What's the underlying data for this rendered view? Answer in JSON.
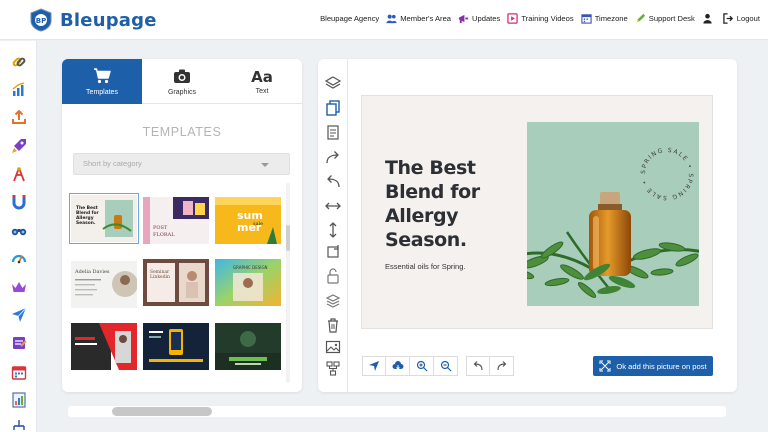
{
  "brand": {
    "name": "Bleupage",
    "logo_text": "BP"
  },
  "topnav": [
    {
      "label": "Bleupage Agency",
      "icon": "none"
    },
    {
      "label": "Member's Area",
      "icon": "users-icon"
    },
    {
      "label": "Updates",
      "icon": "megaphone-icon"
    },
    {
      "label": "Training Videos",
      "icon": "video-icon"
    },
    {
      "label": "Timezone",
      "icon": "calendar-icon"
    },
    {
      "label": "Support Desk",
      "icon": "pencil-icon"
    },
    {
      "label": "",
      "icon": "user-icon"
    },
    {
      "label": "Logout",
      "icon": "logout-icon"
    }
  ],
  "sidebar_icons": [
    "link-icon",
    "bar-chart-icon",
    "upload-icon",
    "rocket-icon",
    "tower-icon",
    "magnet-icon",
    "binoculars-icon",
    "gauge-icon",
    "crown-icon",
    "send-icon",
    "checklist-icon",
    "calendar-icon",
    "report-icon",
    "network-icon"
  ],
  "templates_panel": {
    "tabs": [
      {
        "label": "Templates",
        "icon": "cart-icon"
      },
      {
        "label": "Graphics",
        "icon": "camera-icon"
      },
      {
        "label": "Text",
        "icon": "text-icon",
        "glyph": "Aa"
      }
    ],
    "title": "TEMPLATES",
    "sort_placeholder": "Short by category",
    "thumbnails": [
      {
        "name": "allergy-season",
        "text": "The Best Blend for Allergy Season."
      },
      {
        "name": "post-floral",
        "text": "POST FLORAL"
      },
      {
        "name": "summer-sale",
        "text": "sum sale mer"
      },
      {
        "name": "adelia-davies",
        "text": "Adelia Davies"
      },
      {
        "name": "seminar-linkedin",
        "text": "Seminar Linkedin"
      },
      {
        "name": "graphic-designer",
        "text": "GRAPHIC DESIGNER"
      },
      {
        "name": "business-red",
        "text": ""
      },
      {
        "name": "dark-phone",
        "text": ""
      },
      {
        "name": "digital-marketing",
        "text": "DIGITAL MARKETING AGENCY"
      }
    ]
  },
  "editor": {
    "headline": [
      "The Best",
      "Blend for",
      "Allergy",
      "Season."
    ],
    "subline": "Essential oils for Spring.",
    "circle_badge": "SPRING SALE • SPRING SALE •",
    "ok_button": "Ok add this picture on post",
    "tools": [
      "layers-icon",
      "copy-icon",
      "paste-icon",
      "redo-arrow-icon",
      "undo-arrow-icon",
      "flip-horizontal-icon",
      "flip-vertical-icon",
      "rotate-icon",
      "unlock-icon",
      "layer-stack-icon",
      "trash-icon",
      "image-icon",
      "group-icon"
    ],
    "bottom_tools": [
      "pointer-icon",
      "cloud-download-icon",
      "zoom-in-icon",
      "zoom-out-icon",
      "undo-icon",
      "redo-icon"
    ]
  },
  "colors": {
    "brand": "#1e5fa9",
    "canvas_bg": "#f4f1ee",
    "photo_bg": "#a9cdbb"
  }
}
